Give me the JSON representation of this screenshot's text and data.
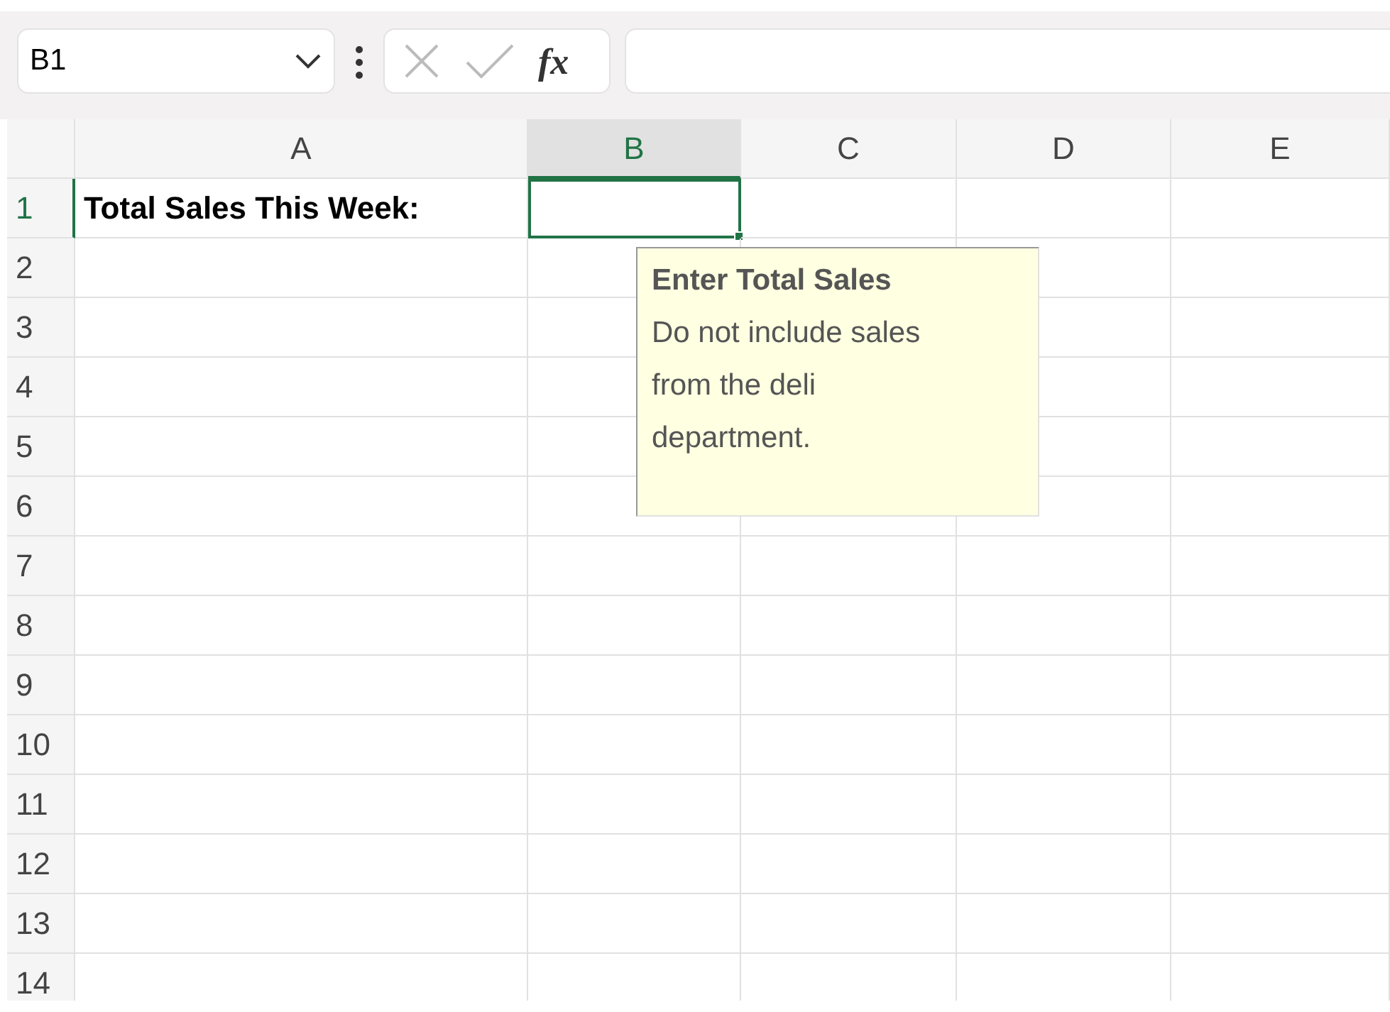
{
  "name_box": {
    "value": "B1"
  },
  "formula_buttons": [
    {
      "kind": "cancel",
      "disabled": true
    },
    {
      "kind": "enter",
      "disabled": true
    },
    {
      "kind": "function",
      "label": "fx",
      "disabled": false
    }
  ],
  "columns": [
    {
      "label": "A",
      "selected": false
    },
    {
      "label": "B",
      "selected": true
    },
    {
      "label": "C",
      "selected": false
    },
    {
      "label": "D",
      "selected": false
    },
    {
      "label": "E",
      "selected": false
    }
  ],
  "rows": [
    {
      "label": "1",
      "selected": true,
      "cells": [
        {
          "text": "Total Sales This Week:",
          "bold": true,
          "selected": false
        },
        {
          "selected": true
        }
      ]
    },
    {
      "label": "2",
      "selected": false
    },
    {
      "label": "3",
      "selected": false
    },
    {
      "label": "4",
      "selected": false
    },
    {
      "label": "5",
      "selected": false
    },
    {
      "label": "6",
      "selected": false
    },
    {
      "label": "7",
      "selected": false
    },
    {
      "label": "8",
      "selected": false
    },
    {
      "label": "9",
      "selected": false
    },
    {
      "label": "10",
      "selected": false
    },
    {
      "label": "11",
      "selected": false
    },
    {
      "label": "12",
      "selected": false
    },
    {
      "label": "13",
      "selected": false
    },
    {
      "label": "14",
      "selected": false
    }
  ],
  "tooltip": {
    "title": "Enter Total Sales",
    "text": "Do not include sales from the deli department."
  }
}
